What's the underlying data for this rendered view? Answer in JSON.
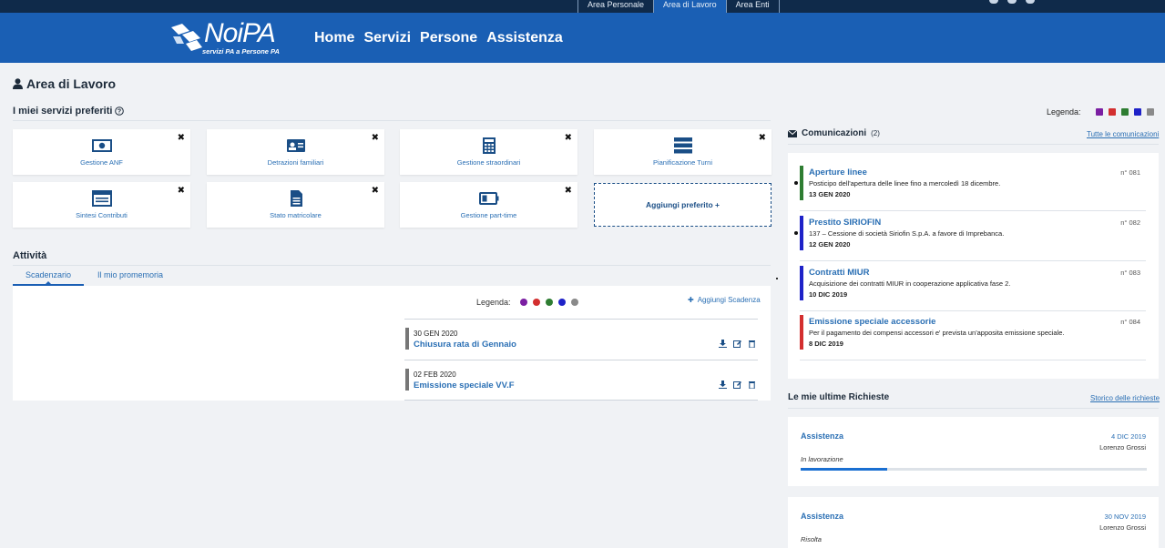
{
  "top_tabs": [
    {
      "label": "Area Personale"
    },
    {
      "label": "Area di Lavoro"
    },
    {
      "label": "Area Enti"
    }
  ],
  "logo": {
    "name": "NoiPA",
    "tagline": "servizi PA a Persone PA"
  },
  "nav": {
    "home": "Home",
    "servizi": "Servizi",
    "persone": "Persone",
    "assistenza": "Assistenza"
  },
  "page_title": "Area di Lavoro",
  "favorites": {
    "title": "I miei servizi preferiti",
    "items": [
      {
        "label": "Gestione ANF",
        "icon": "money-icon"
      },
      {
        "label": "Detrazioni familiari",
        "icon": "id-card-icon"
      },
      {
        "label": "Gestione straordinari",
        "icon": "calculator-icon"
      },
      {
        "label": "Pianificazione Turni",
        "icon": "server-icon"
      },
      {
        "label": "Sintesi Contributi",
        "icon": "list-icon"
      },
      {
        "label": "Stato matricolare",
        "icon": "document-icon"
      },
      {
        "label": "Gestione part-time",
        "icon": "battery-icon"
      }
    ],
    "add_label": "Aggiungi preferito +"
  },
  "activity": {
    "title": "Attività",
    "tabs": [
      "Scadenzario",
      "Il mio promemoria"
    ],
    "legend_label": "Legenda:",
    "add_label": "Aggiungi Scadenza",
    "items": [
      {
        "date": "30 GEN 2020",
        "title": "Chiusura rata di Gennaio"
      },
      {
        "date": "02 FEB 2020",
        "title": "Emissione speciale VV.F"
      }
    ]
  },
  "legend_colors": [
    "#7b1fa2",
    "#d32f2f",
    "#2e7d32",
    "#1e22c8",
    "#8a8a8a"
  ],
  "communications": {
    "legend_label": "Legenda:",
    "title": "Comunicazioni",
    "count": "(2)",
    "all_link": "Tutte le comunicazioni",
    "items": [
      {
        "title": "Aperture linee",
        "num": "n° 081",
        "desc": "Posticipo dell'apertura delle linee fino a mercoledì 18 dicembre.",
        "date": "13 GEN 2020",
        "color": "#2e7d32"
      },
      {
        "title": "Prestito SIRIOFIN",
        "num": "n° 082",
        "desc": "137 – Cessione di società Siriofin S.p.A. a favore di Imprebanca.",
        "date": "12 GEN 2020",
        "color": "#1e22c8"
      },
      {
        "title": "Contratti MIUR",
        "num": "n° 083",
        "desc": "Acquisizione dei contratti MIUR in cooperazione applicativa fase 2.",
        "date": "10 DIC 2019",
        "color": "#1e22c8"
      },
      {
        "title": "Emissione speciale accessorie",
        "num": "n° 084",
        "desc": "Per il pagamento dei compensi accessori e' prevista un'apposita emissione speciale.",
        "date": "8 DIC 2019",
        "color": "#d32f2f"
      }
    ]
  },
  "requests": {
    "title": "Le mie ultime Richieste",
    "history_link": "Storico delle richieste",
    "items": [
      {
        "title": "Assistenza",
        "date": "4 DIC 2019",
        "user": "Lorenzo Grossi",
        "status": "In lavorazione",
        "progress": 0.25
      },
      {
        "title": "Assistenza",
        "date": "30 NOV 2019",
        "user": "Lorenzo Grossi",
        "status": "Risolta"
      }
    ]
  }
}
